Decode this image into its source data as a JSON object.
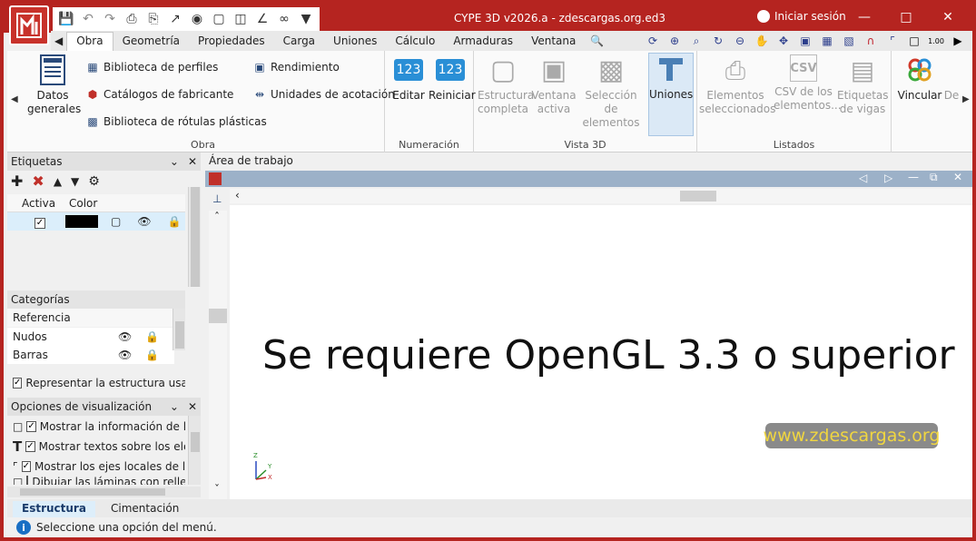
{
  "window": {
    "title": "CYPE 3D v2026.a - zdescargas.org.ed3",
    "signin_label": "Iniciar sesión",
    "accent": "#b52420"
  },
  "ribbon_tabs": [
    "Obra",
    "Geometría",
    "Propiedades",
    "Carga",
    "Uniones",
    "Cálculo",
    "Armaduras",
    "Ventana"
  ],
  "ribbon": {
    "obra": {
      "label": "Obra",
      "datos_generales": "Datos generales",
      "biblioteca_perfiles": "Biblioteca de perfiles",
      "catalogos_fabricante": "Catálogos de fabricante",
      "biblioteca_rotulas": "Biblioteca de rótulas plásticas",
      "rendimiento": "Rendimiento",
      "unidades_acotacion": "Unidades de acotación"
    },
    "numeracion": {
      "label": "Numeración",
      "editar": "Editar",
      "reiniciar": "Reiniciar",
      "icon_text": "123"
    },
    "vista3d": {
      "label": "Vista 3D",
      "estructura_completa": "Estructura completa",
      "ventana_activa": "Ventana activa",
      "seleccion_elementos": "Selección de elementos",
      "uniones": "Uniones"
    },
    "listados": {
      "label": "Listados",
      "elementos_seleccionados": "Elementos seleccionados",
      "csv_elementos": "CSV de los elementos...",
      "etiquetas_vigas": "Etiquetas de vigas",
      "csv_icon_text": "CSV"
    },
    "extra": {
      "vincular": "Vincular",
      "de": "De"
    }
  },
  "etiquetas_panel": {
    "title": "Etiquetas",
    "col_activa": "Activa",
    "col_color": "Color",
    "row_color": "#000000"
  },
  "categorias_panel": {
    "title": "Categorías",
    "col_referencia": "Referencia",
    "rows": [
      "Nudos",
      "Barras"
    ],
    "representar": "Representar la estructura usando"
  },
  "opciones_panel": {
    "title": "Opciones de visualización",
    "items": [
      "Mostrar la información de los",
      "Mostrar textos sobre los elem",
      "Mostrar los ejes locales de los",
      "Dibujar las láminas con relleno"
    ]
  },
  "work_area": {
    "title": "Área de trabajo",
    "message": "Se requiere OpenGL 3.3 o superior",
    "watermark": "www.zdescargas.org",
    "axes": {
      "z": "Z",
      "y": "Y",
      "x": "X"
    }
  },
  "bottom_tabs": [
    "Estructura",
    "Cimentación"
  ],
  "status": {
    "message": "Seleccione una opción del menú."
  }
}
